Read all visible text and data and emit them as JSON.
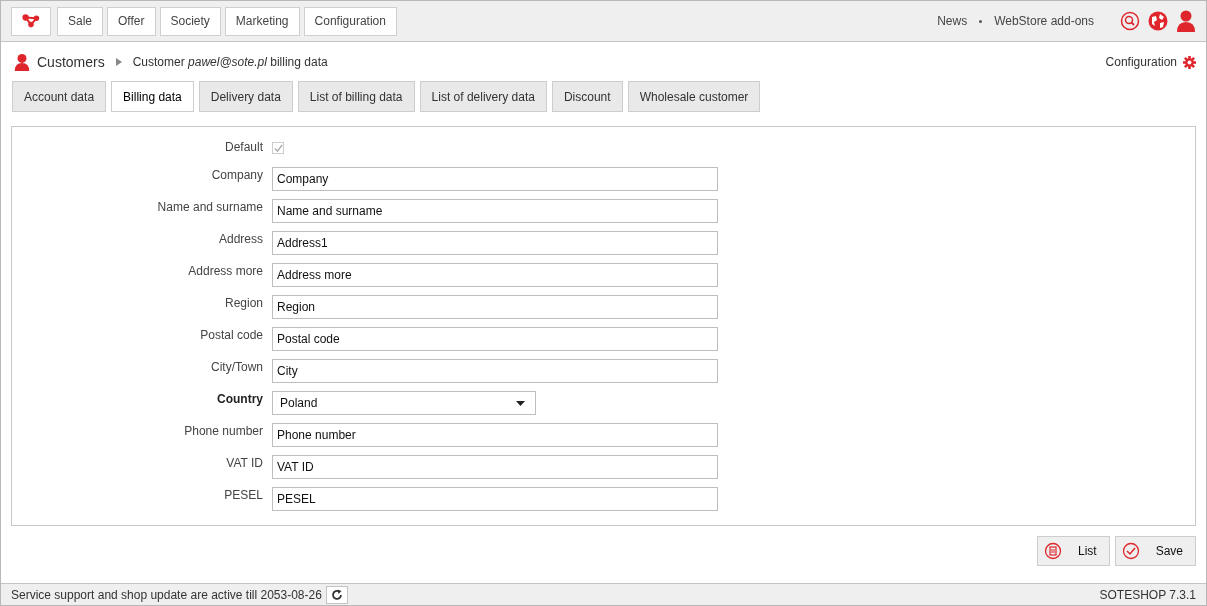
{
  "top_menu": [
    {
      "label": "Sale"
    },
    {
      "label": "Offer"
    },
    {
      "label": "Society"
    },
    {
      "label": "Marketing"
    },
    {
      "label": "Configuration"
    }
  ],
  "top_links": [
    "News",
    "WebStore add-ons"
  ],
  "breadcrumb": {
    "section": "Customers",
    "page": "Customer *pawel@sote.pl* billing data"
  },
  "config_link": "Configuration",
  "tabs": [
    {
      "label": "Account data",
      "selected": false
    },
    {
      "label": "Billing data",
      "selected": true
    },
    {
      "label": "Delivery data",
      "selected": false
    },
    {
      "label": "List of billing data",
      "selected": false
    },
    {
      "label": "List of delivery data",
      "selected": false
    },
    {
      "label": "Discount",
      "selected": false
    },
    {
      "label": "Wholesale customer",
      "selected": false
    }
  ],
  "fields": [
    {
      "kind": "checkbox",
      "label": "Default",
      "checked": true,
      "disabled": true,
      "required": false
    },
    {
      "kind": "text",
      "label": "Company",
      "value": "Company",
      "required": false
    },
    {
      "kind": "text",
      "label": "Name and surname",
      "value": "Name and surname",
      "required": false
    },
    {
      "kind": "text",
      "label": "Address",
      "value": "Address1",
      "required": false
    },
    {
      "kind": "text",
      "label": "Address more",
      "value": "Address more",
      "required": false
    },
    {
      "kind": "text",
      "label": "Region",
      "value": "Region",
      "required": false
    },
    {
      "kind": "text",
      "label": "Postal code",
      "value": "Postal code",
      "required": false
    },
    {
      "kind": "text",
      "label": "City/Town",
      "value": "City",
      "required": false
    },
    {
      "kind": "select",
      "label": "Country",
      "value": "Poland",
      "required": true
    },
    {
      "kind": "text",
      "label": "Phone number",
      "value": "Phone number",
      "required": false
    },
    {
      "kind": "text",
      "label": "VAT ID",
      "value": "VAT ID",
      "required": false
    },
    {
      "kind": "text",
      "label": "PESEL",
      "value": "PESEL",
      "required": false
    }
  ],
  "actions": [
    {
      "kind": "list",
      "label": "List"
    },
    {
      "kind": "save",
      "label": "Save"
    }
  ],
  "status_bar": {
    "message": "Service support and shop update are active till 2053-08-26",
    "version": "SOTESHOP 7.3.1"
  }
}
